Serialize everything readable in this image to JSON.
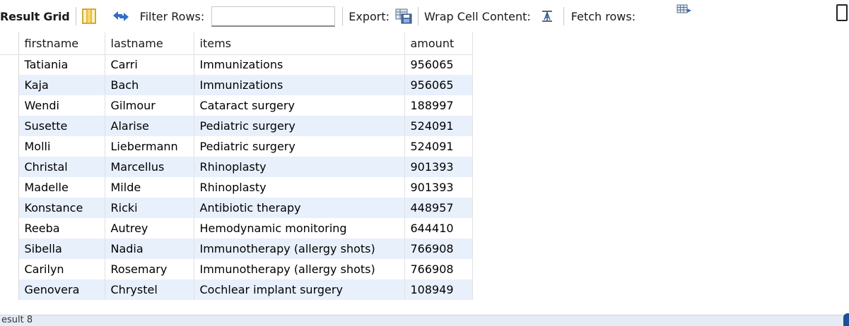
{
  "toolbar": {
    "title": "Result Grid",
    "filter_label": "Filter Rows:",
    "filter_value": "",
    "export_label": "Export:",
    "wrap_label": "Wrap Cell Content:",
    "fetch_label": "Fetch rows:"
  },
  "grid": {
    "columns": [
      "firstname",
      "lastname",
      "items",
      "amount"
    ],
    "rows": [
      [
        "Tatiania",
        "Carri",
        "Immunizations",
        "956065"
      ],
      [
        "Kaja",
        "Bach",
        "Immunizations",
        "956065"
      ],
      [
        "Wendi",
        "Gilmour",
        "Cataract surgery",
        "188997"
      ],
      [
        "Susette",
        "Alarise",
        "Pediatric surgery",
        "524091"
      ],
      [
        "Molli",
        "Liebermann",
        "Pediatric surgery",
        "524091"
      ],
      [
        "Christal",
        "Marcellus",
        "Rhinoplasty",
        "901393"
      ],
      [
        "Madelle",
        "Milde",
        "Rhinoplasty",
        "901393"
      ],
      [
        "Konstance",
        "Ricki",
        "Antibiotic therapy",
        "448957"
      ],
      [
        "Reeba",
        "Autrey",
        "Hemodynamic monitoring",
        "644410"
      ],
      [
        "Sibella",
        "Nadia",
        "Immunotherapy (allergy shots)",
        "766908"
      ],
      [
        "Carilyn",
        "Rosemary",
        "Immunotherapy (allergy shots)",
        "766908"
      ],
      [
        "Genovera",
        "Chrystel",
        "Cochlear implant surgery",
        "108949"
      ]
    ]
  },
  "bottom_tab": {
    "label": "esult 8"
  },
  "colors": {
    "row_alt": "#e8f0fc",
    "grid_line": "#e1e1e1",
    "accent": "#1f4e9a"
  },
  "icons": [
    "grid-toggle-icon",
    "refresh-arrows-icon",
    "export-save-icon",
    "wrap-cell-icon",
    "fetch-rows-icon"
  ]
}
